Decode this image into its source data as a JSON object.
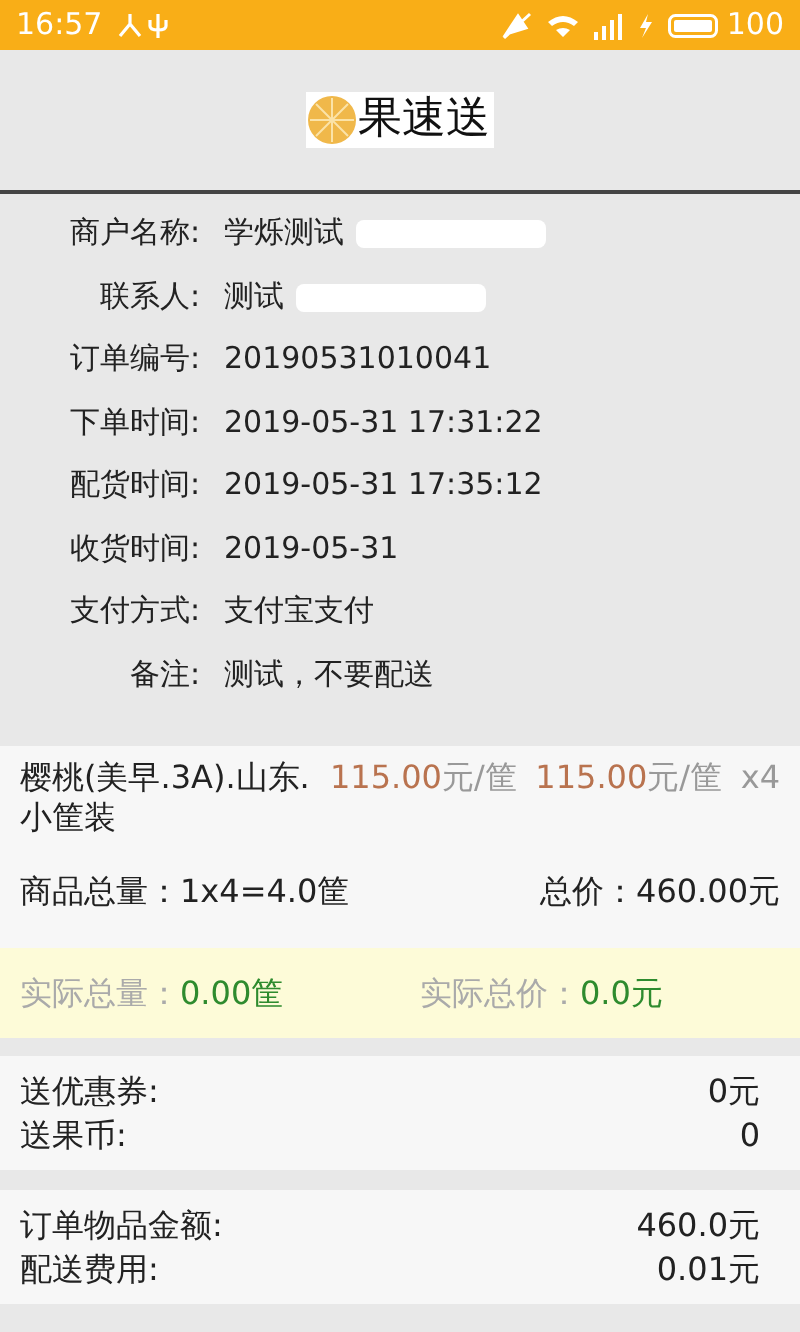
{
  "status_bar": {
    "time": "16:57",
    "battery": "100"
  },
  "header": {
    "brand": "果速送"
  },
  "order_info": [
    {
      "label": "商户名称:",
      "value": "学烁测试",
      "redacted": true
    },
    {
      "label": "联系人:",
      "value": "测试",
      "redacted": true
    },
    {
      "label": "订单编号:",
      "value": "20190531010041",
      "redacted": false
    },
    {
      "label": "下单时间:",
      "value": "2019-05-31 17:31:22",
      "redacted": false
    },
    {
      "label": "配货时间:",
      "value": "2019-05-31 17:35:12",
      "redacted": false
    },
    {
      "label": "收货时间:",
      "value": "2019-05-31",
      "redacted": false
    },
    {
      "label": "支付方式:",
      "value": "支付宝支付",
      "redacted": false
    },
    {
      "label": "备注:",
      "value": "测试，不要配送",
      "redacted": false
    }
  ],
  "items": [
    {
      "name": "樱桃(美早.3A).山东.小筐装",
      "price": "115.00",
      "price_unit": "元/筐",
      "actual_price": "115.00",
      "actual_unit": "元/筐",
      "quantity": "x4"
    }
  ],
  "item_summary": {
    "quantity": "商品总量：1x4=4.0筐",
    "total": "总价：460.00元"
  },
  "actual": {
    "quantity_label": "实际总量：",
    "quantity": "0.00筐",
    "total_label": "实际总价：",
    "total": "0.0元"
  },
  "rewards": [
    {
      "label": "送优惠券:",
      "value": "0元"
    },
    {
      "label": "送果币:",
      "value": "0"
    }
  ],
  "amounts": [
    {
      "label": "订单物品金额:",
      "value": "460.0元"
    },
    {
      "label": "配送费用:",
      "value": "0.01元"
    }
  ]
}
